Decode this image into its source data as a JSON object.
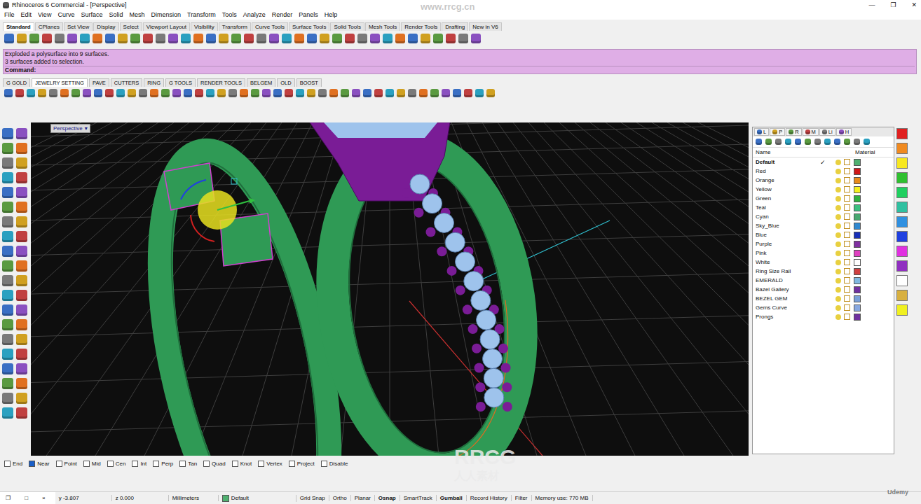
{
  "window": {
    "title": "Rhinoceros 6 Commercial - [Perspective]",
    "controls": [
      "—",
      "❐",
      "✕"
    ]
  },
  "menu": [
    "File",
    "Edit",
    "View",
    "Curve",
    "Surface",
    "Solid",
    "Mesh",
    "Dimension",
    "Transform",
    "Tools",
    "Analyze",
    "Render",
    "Panels",
    "Help"
  ],
  "toolbar_tabs": [
    {
      "label": "Standard",
      "selected": true
    },
    {
      "label": "CPlanes",
      "selected": false
    },
    {
      "label": "Set View",
      "selected": false
    },
    {
      "label": "Display",
      "selected": false
    },
    {
      "label": "Select",
      "selected": false
    },
    {
      "label": "Viewport Layout",
      "selected": false
    },
    {
      "label": "Visibility",
      "selected": false
    },
    {
      "label": "Transform",
      "selected": false
    },
    {
      "label": "Curve Tools",
      "selected": false
    },
    {
      "label": "Surface Tools",
      "selected": false
    },
    {
      "label": "Solid Tools",
      "selected": false
    },
    {
      "label": "Mesh Tools",
      "selected": false
    },
    {
      "label": "Render Tools",
      "selected": false
    },
    {
      "label": "Drafting",
      "selected": false
    },
    {
      "label": "New in V6",
      "selected": false
    }
  ],
  "command_history": [
    "Exploded a polysurface into 9 surfaces.",
    "3 surfaces added to selection."
  ],
  "command_prompt": "Command:",
  "plugin_tabs": [
    {
      "label": "G GOLD",
      "selected": false
    },
    {
      "label": "JEWELRY SETTING",
      "selected": true
    },
    {
      "label": "PAVE",
      "selected": false
    },
    {
      "label": "CUTTERS",
      "selected": false
    },
    {
      "label": "RING",
      "selected": false
    },
    {
      "label": "G TOOLS",
      "selected": false
    },
    {
      "label": "RENDER TOOLS",
      "selected": false
    },
    {
      "label": "BELGEM",
      "selected": false
    },
    {
      "label": "OLD",
      "selected": false
    },
    {
      "label": "BOOST",
      "selected": false
    }
  ],
  "viewport": {
    "label": "Perspective",
    "menu_glyph": "▾"
  },
  "layers": {
    "tabs": [
      "L",
      "P",
      "R",
      "M",
      "Li",
      "H"
    ],
    "columns": [
      "Name",
      "Material"
    ],
    "rows": [
      {
        "name": "Default",
        "current": true,
        "color": "#4fb070"
      },
      {
        "name": "Red",
        "current": false,
        "color": "#d01818"
      },
      {
        "name": "Orange",
        "current": false,
        "color": "#e88a1a"
      },
      {
        "name": "Yellow",
        "current": false,
        "color": "#f4f020"
      },
      {
        "name": "Green",
        "current": false,
        "color": "#30b040"
      },
      {
        "name": "Teal",
        "current": false,
        "color": "#3cc080"
      },
      {
        "name": "Cyan",
        "current": false,
        "color": "#48a870"
      },
      {
        "name": "Sky_Blue",
        "current": false,
        "color": "#3088d0"
      },
      {
        "name": "Blue",
        "current": false,
        "color": "#1830b8"
      },
      {
        "name": "Purple",
        "current": false,
        "color": "#8030a0"
      },
      {
        "name": "Pink",
        "current": false,
        "color": "#e040c0"
      },
      {
        "name": "White",
        "current": false,
        "color": "#ffffff"
      },
      {
        "name": "Ring Size Rail",
        "current": false,
        "color": "#d04040"
      },
      {
        "name": "EMERALD",
        "current": false,
        "color": "#80b8e0"
      },
      {
        "name": "Bazel Gallery",
        "current": false,
        "color": "#7030a0"
      },
      {
        "name": "BEZEL GEM",
        "current": false,
        "color": "#7aa0d8"
      },
      {
        "name": "Gems Curve",
        "current": false,
        "color": "#88a8e0"
      },
      {
        "name": "Prongs",
        "current": false,
        "color": "#7030a0"
      }
    ]
  },
  "color_buttons": [
    {
      "color": "#e02020"
    },
    {
      "color": "#f08a20"
    },
    {
      "color": "#f8e820"
    },
    {
      "color": "#30c030"
    },
    {
      "color": "#20d060"
    },
    {
      "color": "#30c0a0"
    },
    {
      "color": "#3090e0"
    },
    {
      "color": "#2040e0"
    },
    {
      "color": "#e030e0"
    },
    {
      "color": "#9030c0"
    },
    {
      "color": "#ffffff"
    },
    {
      "color": "#d8b040"
    },
    {
      "color": "#f0f020"
    }
  ],
  "osnaps": [
    {
      "label": "End",
      "checked": false
    },
    {
      "label": "Near",
      "checked": true
    },
    {
      "label": "Point",
      "checked": false
    },
    {
      "label": "Mid",
      "checked": false
    },
    {
      "label": "Cen",
      "checked": false
    },
    {
      "label": "Int",
      "checked": false
    },
    {
      "label": "Perp",
      "checked": false
    },
    {
      "label": "Tan",
      "checked": false
    },
    {
      "label": "Quad",
      "checked": false
    },
    {
      "label": "Knot",
      "checked": false
    },
    {
      "label": "Vertex",
      "checked": false
    },
    {
      "label": "Project",
      "checked": false
    },
    {
      "label": "Disable",
      "checked": false
    }
  ],
  "status_bar": {
    "window_buttons": [
      "❐",
      "□",
      "×"
    ],
    "coordinates": [
      "y -3.807",
      "z 0.000"
    ],
    "units": "Millimeters",
    "layer": {
      "name": "Default",
      "color": "#4fb070"
    },
    "toggles": [
      {
        "label": "Grid Snap",
        "on": false
      },
      {
        "label": "Ortho",
        "on": false
      },
      {
        "label": "Planar",
        "on": false
      },
      {
        "label": "Osnap",
        "on": true
      },
      {
        "label": "SmartTrack",
        "on": false
      },
      {
        "label": "Gumball",
        "on": true
      },
      {
        "label": "Record History",
        "on": false
      },
      {
        "label": "Filter",
        "on": false
      }
    ],
    "memory": "Memory use: 770 MB"
  },
  "watermarks": [
    "www.rrcg.cn",
    "RRCG",
    "人人素材",
    "Udemy"
  ]
}
